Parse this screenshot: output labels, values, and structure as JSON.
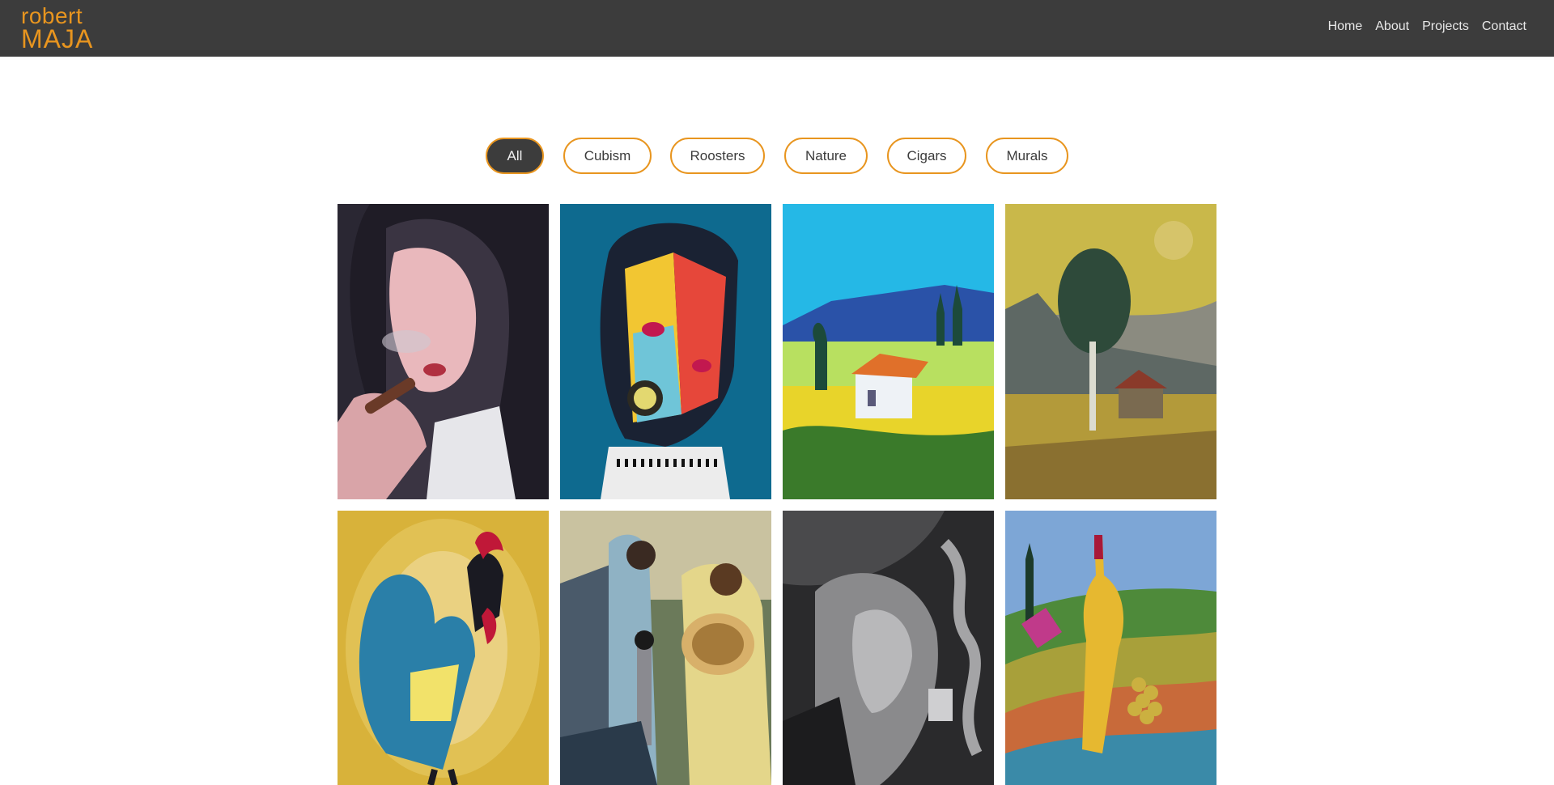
{
  "brand": {
    "line1": "robert",
    "line2": "MAJA",
    "color": "#e8951f"
  },
  "nav": {
    "items": [
      "Home",
      "About",
      "Projects",
      "Contact"
    ]
  },
  "filters": {
    "items": [
      "All",
      "Cubism",
      "Roosters",
      "Nature",
      "Cigars",
      "Murals"
    ],
    "active": "All"
  },
  "gallery": {
    "items": [
      {
        "name": "woman-smoking-cigar-painting"
      },
      {
        "name": "cubist-faces-pipe-painting"
      },
      {
        "name": "landscape-house-painting"
      },
      {
        "name": "tree-house-landscape-painting"
      },
      {
        "name": "rooster-painting"
      },
      {
        "name": "musicians-painting"
      },
      {
        "name": "smoke-portrait-painting"
      },
      {
        "name": "wine-bottle-vineyard-painting"
      }
    ]
  }
}
